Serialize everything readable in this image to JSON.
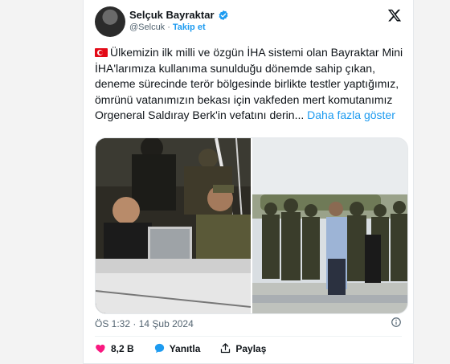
{
  "author": {
    "name": "Selçuk Bayraktar",
    "handle": "@Selcuk",
    "separator": "·",
    "follow_label": "Takip et"
  },
  "tweet": {
    "text": "Ülkemizin ilk milli ve özgün İHA sistemi olan Bayraktar Mini İHA'larımıza kullanıma sunulduğu dönemde sahip çıkan, deneme sürecinde terör bölgesinde birlikte testler yaptığımız, ömrünü vatanımızın bekası için vakfeden mert komutanımız Orgeneral Saldıray Berk'in vefatını derin...",
    "more_label": "Daha fazla göster"
  },
  "meta": {
    "time": "ÖS 1:32",
    "separator": "·",
    "date": "14 Şub 2024"
  },
  "actions": {
    "likes": "8,2 B",
    "reply_label": "Yanıtla",
    "share_label": "Paylaş"
  },
  "icons": {
    "verified": "verified-badge-icon",
    "x_logo": "x-logo-icon",
    "heart": "heart-icon",
    "reply": "reply-icon",
    "share": "share-icon",
    "bookmark": "bookmark-icon"
  },
  "colors": {
    "accent": "#1d9bf0",
    "like": "#f91880",
    "text": "#0f1419",
    "muted": "#536471"
  }
}
